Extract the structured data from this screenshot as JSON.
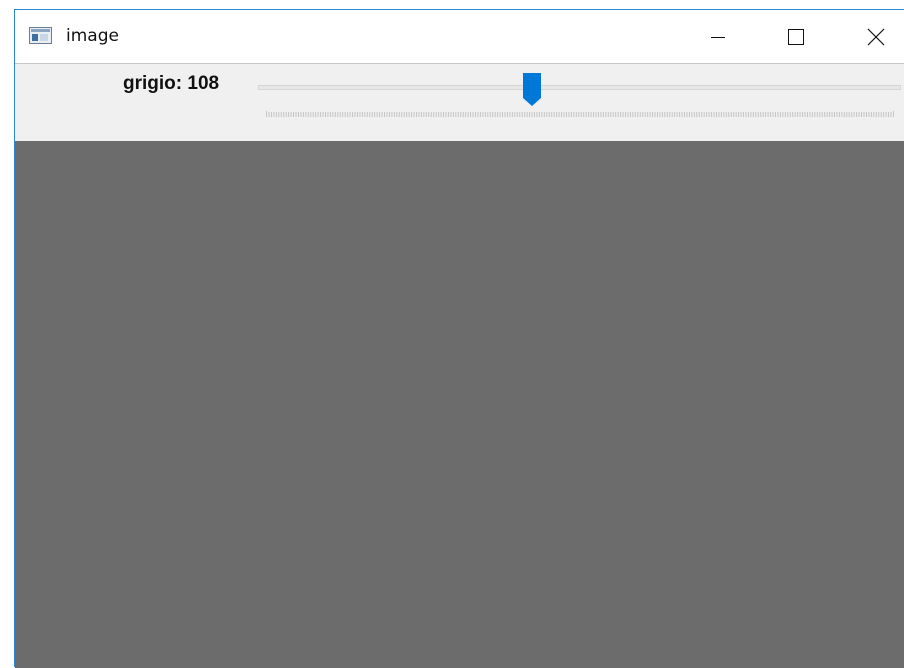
{
  "window": {
    "title": "image",
    "icon": "app-window-icon",
    "controls": [
      "minimize-icon",
      "maximize-icon",
      "close-icon"
    ]
  },
  "trackbar": {
    "label": "grigio: 108",
    "value": 108,
    "min": 0,
    "max": 255,
    "thumb_color": "#0078d7"
  },
  "image": {
    "fill_color": "#6c6c6c"
  }
}
